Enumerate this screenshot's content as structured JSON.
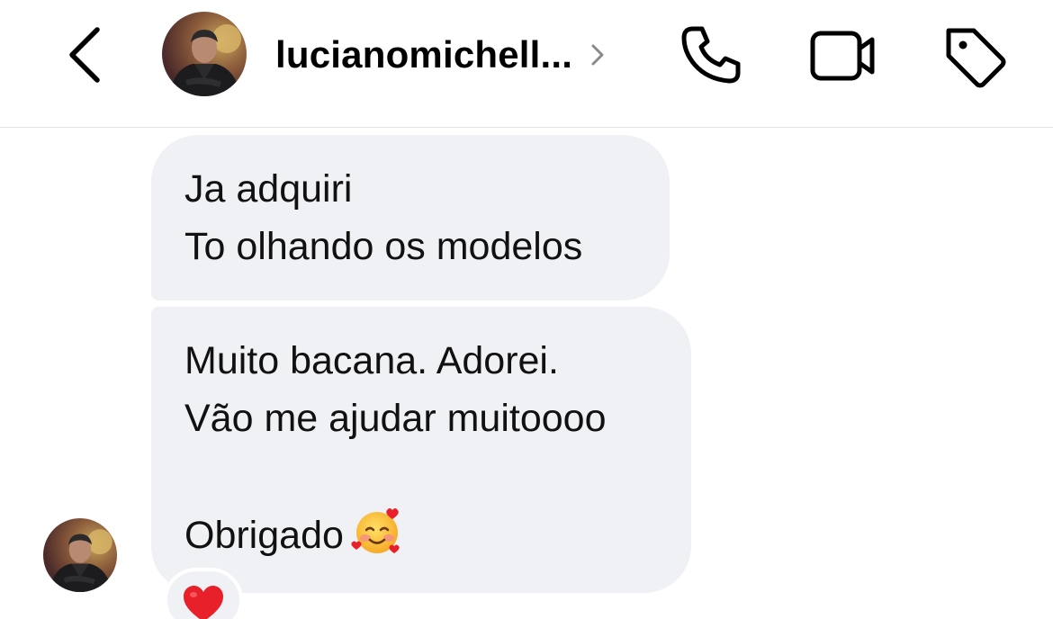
{
  "header": {
    "username": "lucianomichell...",
    "icons": {
      "back": "chevron-left-icon",
      "profile_chevron": "chevron-right-icon",
      "call": "phone-icon",
      "video": "video-camera-icon",
      "tag": "tag-icon"
    }
  },
  "messages": [
    {
      "sender": "other",
      "lines": [
        "Ja adquiri",
        "To olhando os modelos"
      ]
    },
    {
      "sender": "other",
      "lines": [
        "Muito bacana. Adorei.",
        "Vão me ajudar muitoooo",
        "",
        "Obrigado"
      ],
      "emoji": "smiling-face-with-hearts-icon",
      "reaction": "red-heart-icon"
    }
  ],
  "colors": {
    "background": "#ffffff",
    "bubble": "#f0f1f4",
    "text": "#111111",
    "divider": "#e3e3e6",
    "reaction_heart": "#e8202a"
  }
}
